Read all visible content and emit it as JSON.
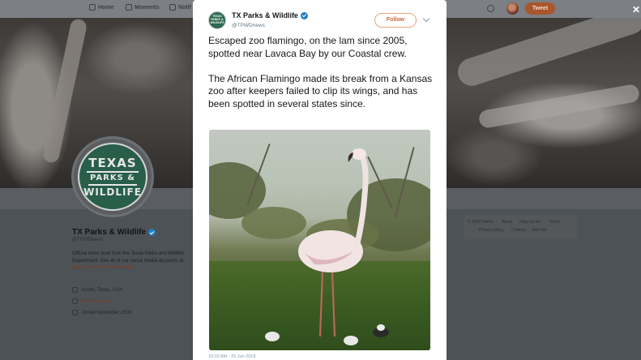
{
  "background": {
    "nav": {
      "home": "Home",
      "moments": "Moments",
      "notifications": "Notif",
      "tweet_button": "Tweet"
    },
    "profile": {
      "logo_lines": [
        "TEXAS",
        "PARKS &",
        "WILDLIFE"
      ],
      "name": "TX Parks & Wildlife",
      "handle": "@TPWDnews",
      "bio": "Official news feed from the Texas Parks and Wildlife Department. See all of our social media accounts at",
      "bio_link": "tpwd.state.tx.us/socialmedia",
      "location": "Austin, Texas, USA",
      "website": "tpwd.texas.gov",
      "joined": "Joined November 2008"
    },
    "footer_links": {
      "row1": [
        "© 2018 Twitter",
        "About",
        "Help Center",
        "Terms"
      ],
      "row2": [
        "Privacy policy",
        "Cookies",
        "Ads info"
      ]
    },
    "close_glyph": "✕"
  },
  "modal": {
    "avatar_lines": [
      "TEXAS",
      "PARKS &",
      "WILDLIFE"
    ],
    "author_name": "TX Parks & Wildlife",
    "author_handle": "@TPWDnews",
    "follow_label": "Follow",
    "paragraph1": "Escaped zoo flamingo, on the lam since 2005, spotted near Lavaca Bay by our Coastal crew.",
    "paragraph2": "The African Flamingo made its break from a Kansas zoo after keepers failed to clip its wings, and has been spotted in several states since.",
    "timestamp": "10:02 AM - 25 Jun 2018"
  },
  "colors": {
    "accent": "#c8663a",
    "verified": "#1d7fc9",
    "tweet_button_bg": "#a9562d"
  },
  "icons": [
    "home-icon",
    "moments-icon",
    "notifications-icon",
    "search-icon",
    "verified-icon",
    "chevron-down-icon",
    "close-icon",
    "location-icon",
    "link-icon",
    "calendar-icon"
  ]
}
